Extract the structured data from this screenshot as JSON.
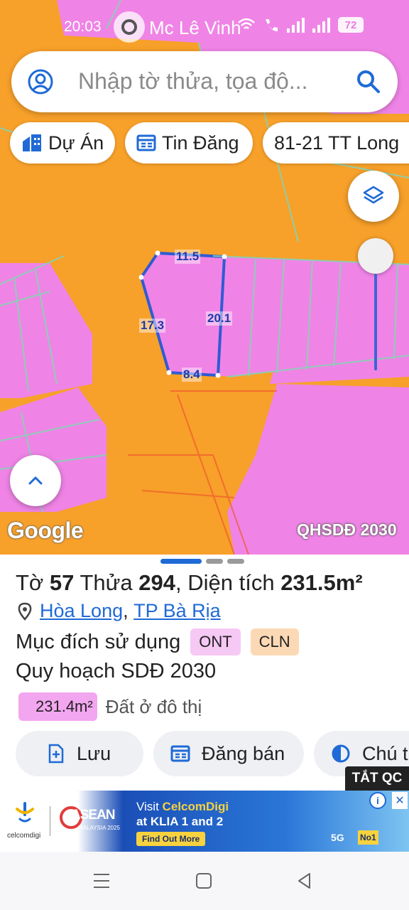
{
  "status_bar": {
    "time": "20:03",
    "title": "Mc Lê Vinh",
    "battery": "72"
  },
  "search": {
    "placeholder": "Nhập tờ thửa, tọa độ..."
  },
  "chips": [
    {
      "label": "Dự Án",
      "icon": "building-icon"
    },
    {
      "label": "Tin Đăng",
      "icon": "listing-icon"
    },
    {
      "label": "81-21 TT Long",
      "icon": ""
    }
  ],
  "map": {
    "provider_logo": "Google",
    "layer_label": "QHSDĐ 2030",
    "edge_labels": {
      "top": "11.5",
      "left": "17.3",
      "right": "20.1",
      "bottom": "8.4"
    },
    "colors": {
      "orange": "#f7a02a",
      "pink": "#ef84e6",
      "border": "#86d3b4",
      "parcel": "#2f5bd3"
    }
  },
  "parcel": {
    "to_label": "Tờ",
    "to_value": "57",
    "thua_label": "Thửa",
    "thua_value": "294",
    "area_label": "Diện tích",
    "area_value": "231.5m²",
    "ward": "Hòa Long",
    "city": "TP Bà Rịa",
    "purpose_label": "Mục đích sử dụng",
    "tags": [
      {
        "label": "ONT",
        "color": "#f6c8f4"
      },
      {
        "label": "CLN",
        "color": "#fcd9b5"
      }
    ],
    "plan_label": "Quy hoạch SDĐ 2030",
    "plan_area": "231.4m²",
    "plan_desc": "Đất ở đô thị"
  },
  "actions": [
    {
      "label": "Lưu",
      "icon": "save-plus-icon"
    },
    {
      "label": "Đăng bán",
      "icon": "post-listing-icon"
    },
    {
      "label": "Chú t",
      "icon": "legend-icon"
    }
  ],
  "ad": {
    "close_label": "TẮT QC",
    "brand": "celcomdigi",
    "event": "ASEAN",
    "event_sub": "MALAYSIA 2025",
    "line1_prefix": "Visit",
    "line1_highlight": "CelcomDigi",
    "line2": "at KLIA 1 and 2",
    "cta": "Find Out More",
    "badge_5g": "5G",
    "badge_no1": "No1"
  }
}
